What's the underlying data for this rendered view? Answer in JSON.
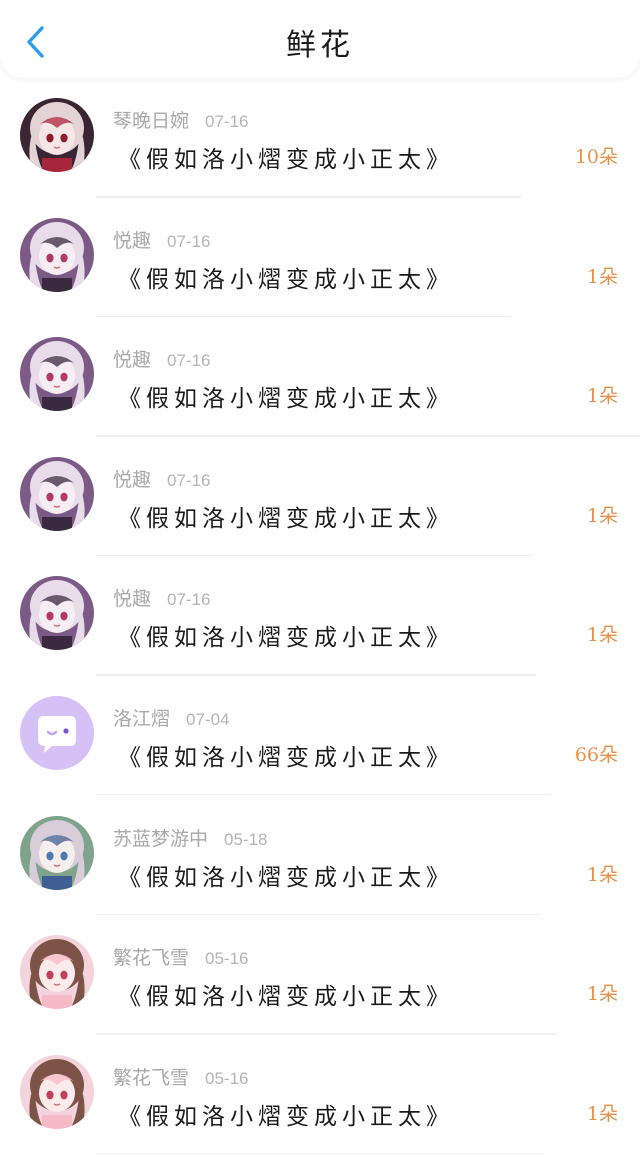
{
  "header": {
    "title": "鲜花",
    "back_icon": "chevron-left-icon",
    "back_color": "#2d9cf0"
  },
  "colors": {
    "count": "#e9904a",
    "meta": "#a8a8a8"
  },
  "items": [
    {
      "name": "琴晚日婉",
      "date": "07-16",
      "work": "《假如洛小熠变成小正太》",
      "count": "10朵",
      "avatar": "girl-dark"
    },
    {
      "name": "悦趣",
      "date": "07-16",
      "work": "《假如洛小熠变成小正太》",
      "count": "1朵",
      "avatar": "girl-purple"
    },
    {
      "name": "悦趣",
      "date": "07-16",
      "work": "《假如洛小熠变成小正太》",
      "count": "1朵",
      "avatar": "girl-purple"
    },
    {
      "name": "悦趣",
      "date": "07-16",
      "work": "《假如洛小熠变成小正太》",
      "count": "1朵",
      "avatar": "girl-purple"
    },
    {
      "name": "悦趣",
      "date": "07-16",
      "work": "《假如洛小熠变成小正太》",
      "count": "1朵",
      "avatar": "girl-purple"
    },
    {
      "name": "洛江熠",
      "date": "07-04",
      "work": "《假如洛小熠变成小正太》",
      "count": "66朵",
      "avatar": "default-chat"
    },
    {
      "name": "苏蓝梦游中",
      "date": "05-18",
      "work": "《假如洛小熠变成小正太》",
      "count": "1朵",
      "avatar": "girl-green"
    },
    {
      "name": "繁花飞雪",
      "date": "05-16",
      "work": "《假如洛小熠变成小正太》",
      "count": "1朵",
      "avatar": "girl-pink"
    },
    {
      "name": "繁花飞雪",
      "date": "05-16",
      "work": "《假如洛小熠变成小正太》",
      "count": "1朵",
      "avatar": "girl-pink"
    }
  ]
}
